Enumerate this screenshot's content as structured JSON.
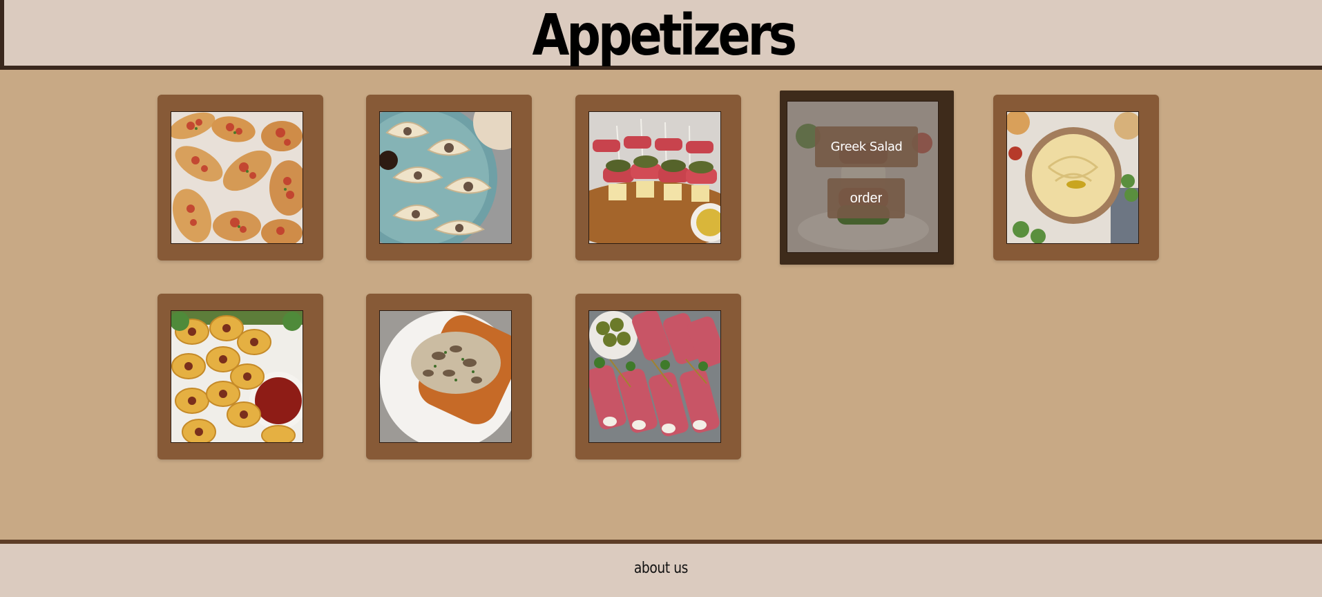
{
  "header": {
    "title": "Appetizers"
  },
  "cards": [
    {
      "id": "bruschetta",
      "image": "bruschetta-image"
    },
    {
      "id": "dumplings",
      "image": "dumplings-image"
    },
    {
      "id": "antipasto-skewers",
      "image": "antipasto-skewers-image"
    },
    {
      "id": "greek-salad",
      "image": "greek-salad-image",
      "title": "Greek Salad",
      "order_label": "order"
    },
    {
      "id": "hummus",
      "image": "hummus-image"
    },
    {
      "id": "pigs-in-blanket",
      "image": "pigs-in-blanket-image"
    },
    {
      "id": "mushroom-toast",
      "image": "mushroom-toast-image"
    },
    {
      "id": "salami-rolls",
      "image": "salami-rolls-image"
    }
  ],
  "footer": {
    "about_label": "about us"
  },
  "colors": {
    "page_bg": "#c8a985",
    "card_bg": "#875a37",
    "card_active_bg": "#3e2b1b",
    "header_bg": "#dbcbbf",
    "border_dark": "#3a281d"
  }
}
